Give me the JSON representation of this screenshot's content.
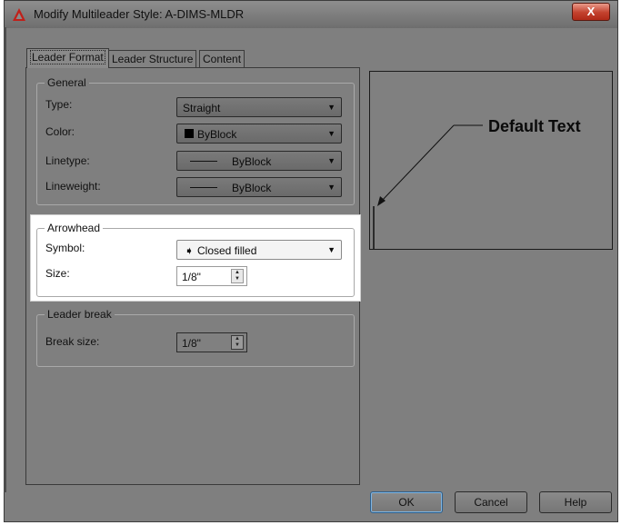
{
  "window": {
    "title": "Modify Multileader Style: A-DIMS-MLDR",
    "close_label": "X"
  },
  "tabs": [
    {
      "label": "Leader Format"
    },
    {
      "label": "Leader Structure"
    },
    {
      "label": "Content"
    }
  ],
  "general": {
    "legend": "General",
    "type_label": "Type:",
    "type_value": "Straight",
    "color_label": "Color:",
    "color_value": "ByBlock",
    "linetype_label": "Linetype:",
    "linetype_value": "ByBlock",
    "lineweight_label": "Lineweight:",
    "lineweight_value": "ByBlock"
  },
  "arrowhead": {
    "legend": "Arrowhead",
    "symbol_label": "Symbol:",
    "symbol_value": "Closed filled",
    "size_label": "Size:",
    "size_value": "1/8\""
  },
  "leader_break": {
    "legend": "Leader break",
    "break_size_label": "Break size:",
    "break_size_value": "1/8\""
  },
  "preview": {
    "text": "Default Text"
  },
  "buttons": {
    "ok": "OK",
    "cancel": "Cancel",
    "help": "Help"
  },
  "colors": {
    "dialog_bg": "#7f7f7f",
    "highlight": "#ffffff",
    "close_red": "#c3412d"
  }
}
